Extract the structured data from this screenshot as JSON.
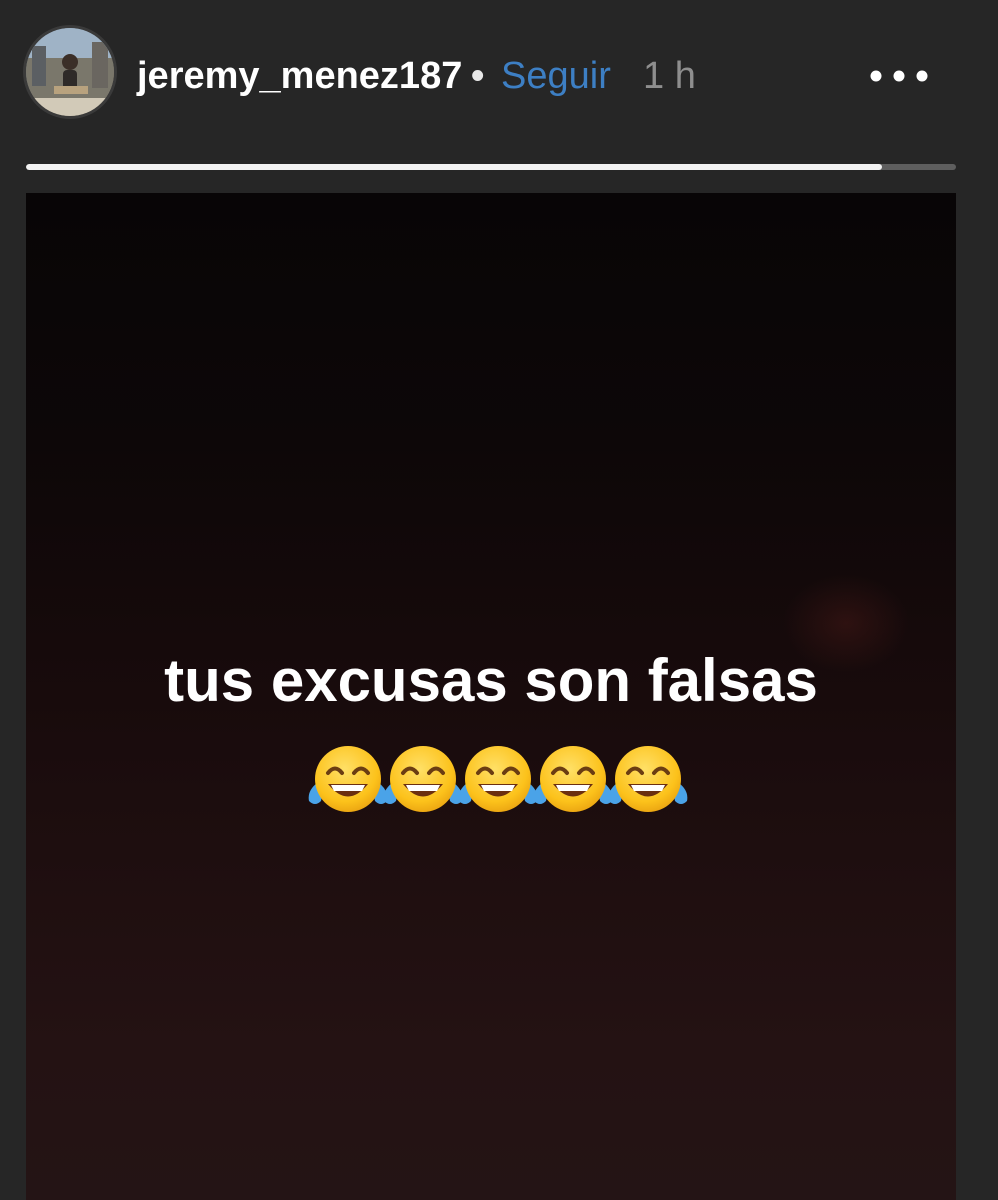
{
  "header": {
    "username": "jeremy_menez187",
    "separator": "•",
    "follow_label": "Seguir",
    "time_ago": "1 h",
    "more_icon": "more-horizontal-icon",
    "avatar_icon": "profile-photo"
  },
  "progress": {
    "fraction": 0.92
  },
  "story": {
    "caption": "tus excusas son falsas",
    "emoji": "face-with-tears-of-joy",
    "emoji_count": 5
  },
  "colors": {
    "background": "#262626",
    "follow": "#3d7fc4",
    "time": "#8e8e8e",
    "text": "#ffffff"
  }
}
